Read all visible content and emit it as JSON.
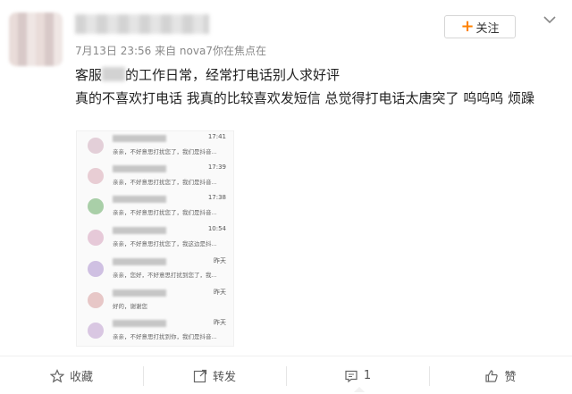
{
  "post": {
    "meta": "7月13日 23:56 来自 nova7你在焦点在",
    "follow_label": "关注",
    "text_line1_a": "客服",
    "text_line1_b": "的工作日常，经常打电话别人求好评",
    "text_line2": "真的不喜欢打电话  我真的比较喜欢发短信  总觉得打电话太唐突了  呜呜呜  烦躁"
  },
  "screenshot": {
    "messages": [
      {
        "time": "17:41",
        "preview": "亲亲，不好意思打扰您了，我们是抖音...",
        "avatar_color": "#e3cfd8"
      },
      {
        "time": "17:39",
        "preview": "亲亲，不好意思打扰您了，我们是抖音...",
        "avatar_color": "#e8cdd4"
      },
      {
        "time": "17:38",
        "preview": "亲亲，不好意思打扰您了，我们是抖音...",
        "avatar_color": "#a9cfa8"
      },
      {
        "time": "10:54",
        "preview": "亲亲，不好意思打扰您了，我这边是抖...",
        "avatar_color": "#e6c9d8"
      },
      {
        "time": "昨天",
        "preview": "亲亲，您好，不好意思打扰到您了，我...",
        "avatar_color": "#cfc0e2"
      },
      {
        "time": "昨天",
        "preview": "好的，谢谢您",
        "avatar_color": "#e7c7c7"
      },
      {
        "time": "昨天",
        "preview": "亲亲，不好意思打扰到你，我们是抖音...",
        "avatar_color": "#d9c7e2"
      }
    ]
  },
  "actions": {
    "favorite_label": "收藏",
    "repost_label": "转发",
    "comment_count": "1",
    "like_label": "赞"
  },
  "colors": {
    "accent": "#ff8200"
  }
}
